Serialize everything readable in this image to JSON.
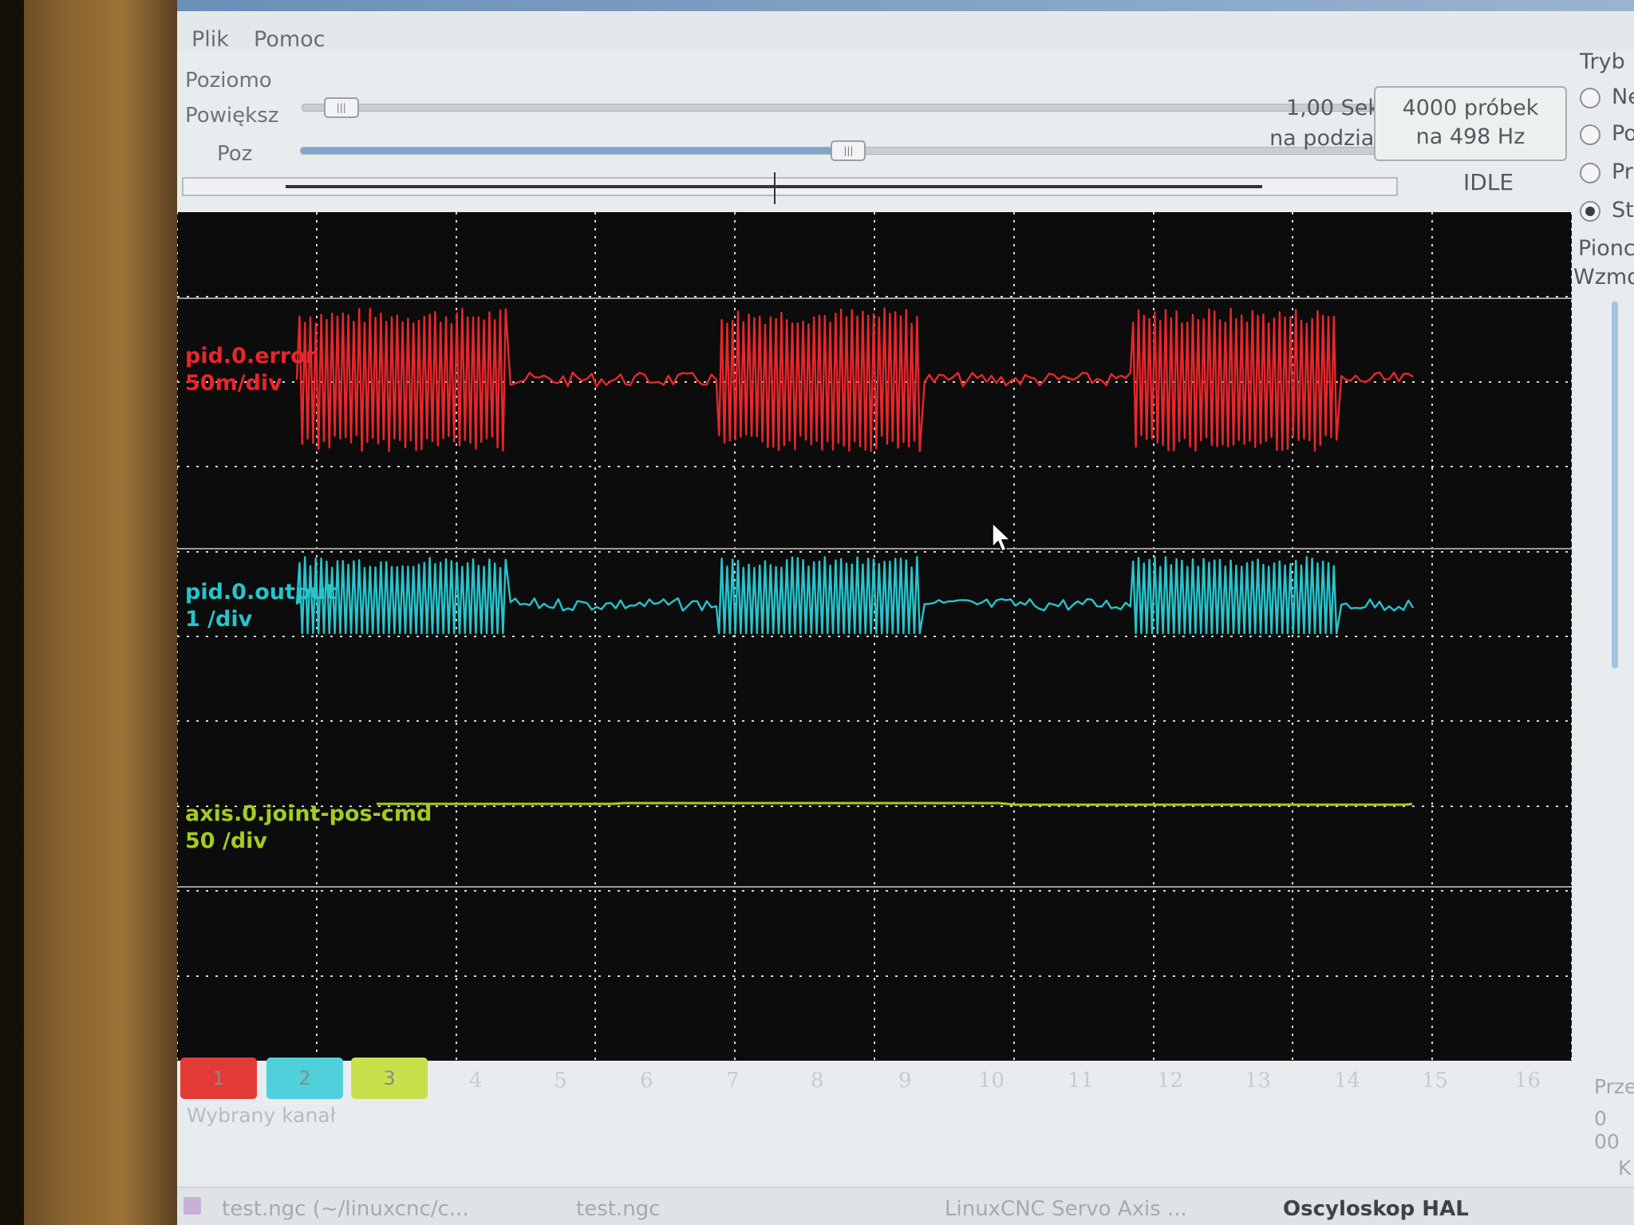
{
  "menu": {
    "file": "Plik",
    "help": "Pomoc"
  },
  "horizontal": {
    "section_label": "Poziomo",
    "zoom_label": "Powiększ",
    "pos_label": "Poz",
    "zoom_level": 0.02,
    "pos_level": 0.51,
    "time_per_div_1": "1,00 Sek",
    "time_per_div_2": "na podział",
    "samples_1": "4000 próbek",
    "samples_2": "na 498 Hz",
    "status": "IDLE"
  },
  "mode": {
    "title": "Tryb",
    "options": [
      "Ne",
      "Po",
      "Pr",
      "St"
    ],
    "selected_index": 3
  },
  "vertical": {
    "title": "Pionc",
    "gain_label": "Wzmo"
  },
  "channels": [
    {
      "name": "pid.0.error",
      "scale": "50m/div",
      "color": "#e8262a"
    },
    {
      "name": "pid.0.output",
      "scale": "1 /div",
      "color": "#27c4cc"
    },
    {
      "name": "axis.0.joint-pos-cmd",
      "scale": "50 /div",
      "color": "#a4cc1e"
    }
  ],
  "channel_buttons": {
    "active": [
      {
        "label": "1",
        "color": "#e23a34"
      },
      {
        "label": "2",
        "color": "#4fd0da"
      },
      {
        "label": "3",
        "color": "#c9e04c"
      }
    ],
    "inactive": [
      "4",
      "5",
      "6",
      "7",
      "8",
      "9",
      "10",
      "11",
      "12",
      "13",
      "14",
      "15",
      "16"
    ],
    "selected_label": "Wybrany kanał"
  },
  "side_panel": {
    "text1": "Prze",
    "text2": "0 00",
    "text3": "K"
  },
  "taskbar": {
    "items": [
      {
        "label": "test.ngc (~/linuxcnc/c...",
        "active": false
      },
      {
        "label": "test.ngc",
        "active": false
      },
      {
        "label": "LinuxCNC Servo Axis ...",
        "active": false
      },
      {
        "label": "Oscyloskop HAL",
        "active": true
      }
    ]
  },
  "colors": {
    "scope_bg": "#0c0c0c",
    "grid": "#d8d8d8"
  }
}
